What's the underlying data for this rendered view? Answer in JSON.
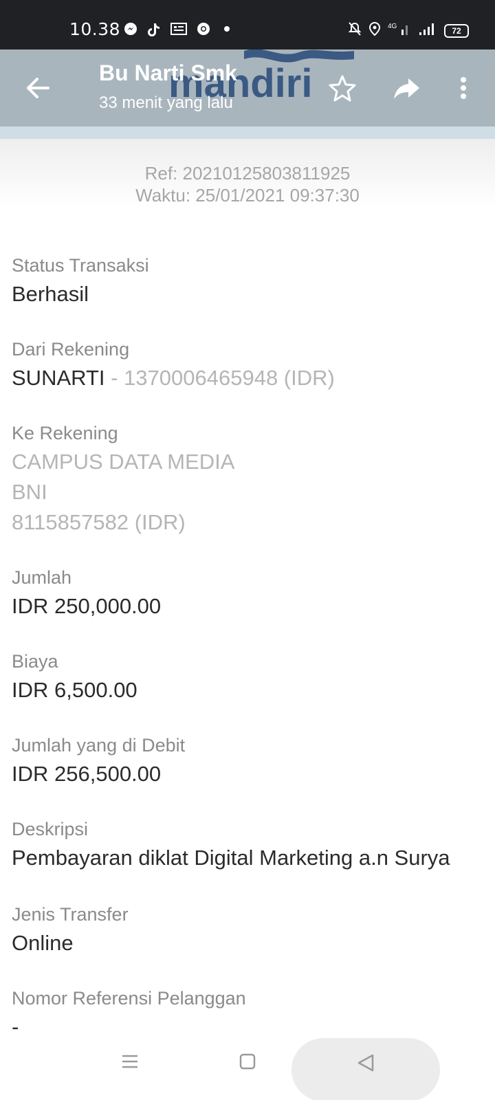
{
  "status_bar": {
    "time": "10.38",
    "left_icons": [
      "messenger-icon",
      "tiktok-icon",
      "news-icon",
      "chrome-icon",
      "dot-icon"
    ],
    "right_icons": [
      "bell-off-icon",
      "location-icon",
      "signal-4g-icon",
      "signal-icon"
    ],
    "battery": "72"
  },
  "header": {
    "title": "Bu Narti Smk",
    "subtitle": "33 menit yang lalu",
    "watermark": "mandiri",
    "bg_color": "#a9b5bd"
  },
  "receipt": {
    "ref": "Ref: 20210125803811925",
    "time": "Waktu: 25/01/2021 09:37:30"
  },
  "fields": {
    "status": {
      "label": "Status Transaksi",
      "value": "Berhasil"
    },
    "from": {
      "label": "Dari Rekening",
      "name": "SUNARTI",
      "account": " - 1370006465948 (IDR)"
    },
    "to": {
      "label": "Ke Rekening",
      "line1": "CAMPUS DATA MEDIA",
      "line2": "BNI",
      "line3": "8115857582 (IDR)"
    },
    "amount": {
      "label": "Jumlah",
      "value": "IDR 250,000.00"
    },
    "fee": {
      "label": "Biaya",
      "value": "IDR 6,500.00"
    },
    "debit": {
      "label": "Jumlah yang di Debit",
      "value": "IDR 256,500.00"
    },
    "description": {
      "label": "Deskripsi",
      "value": "Pembayaran diklat Digital Marketing a.n Surya"
    },
    "transfer_type": {
      "label": "Jenis Transfer",
      "value": "Online"
    },
    "customer_ref": {
      "label": "Nomor Referensi Pelanggan",
      "value": "-"
    }
  },
  "nav": {
    "icons": [
      "menu-icon",
      "home-square-icon",
      "back-triangle-icon"
    ]
  }
}
